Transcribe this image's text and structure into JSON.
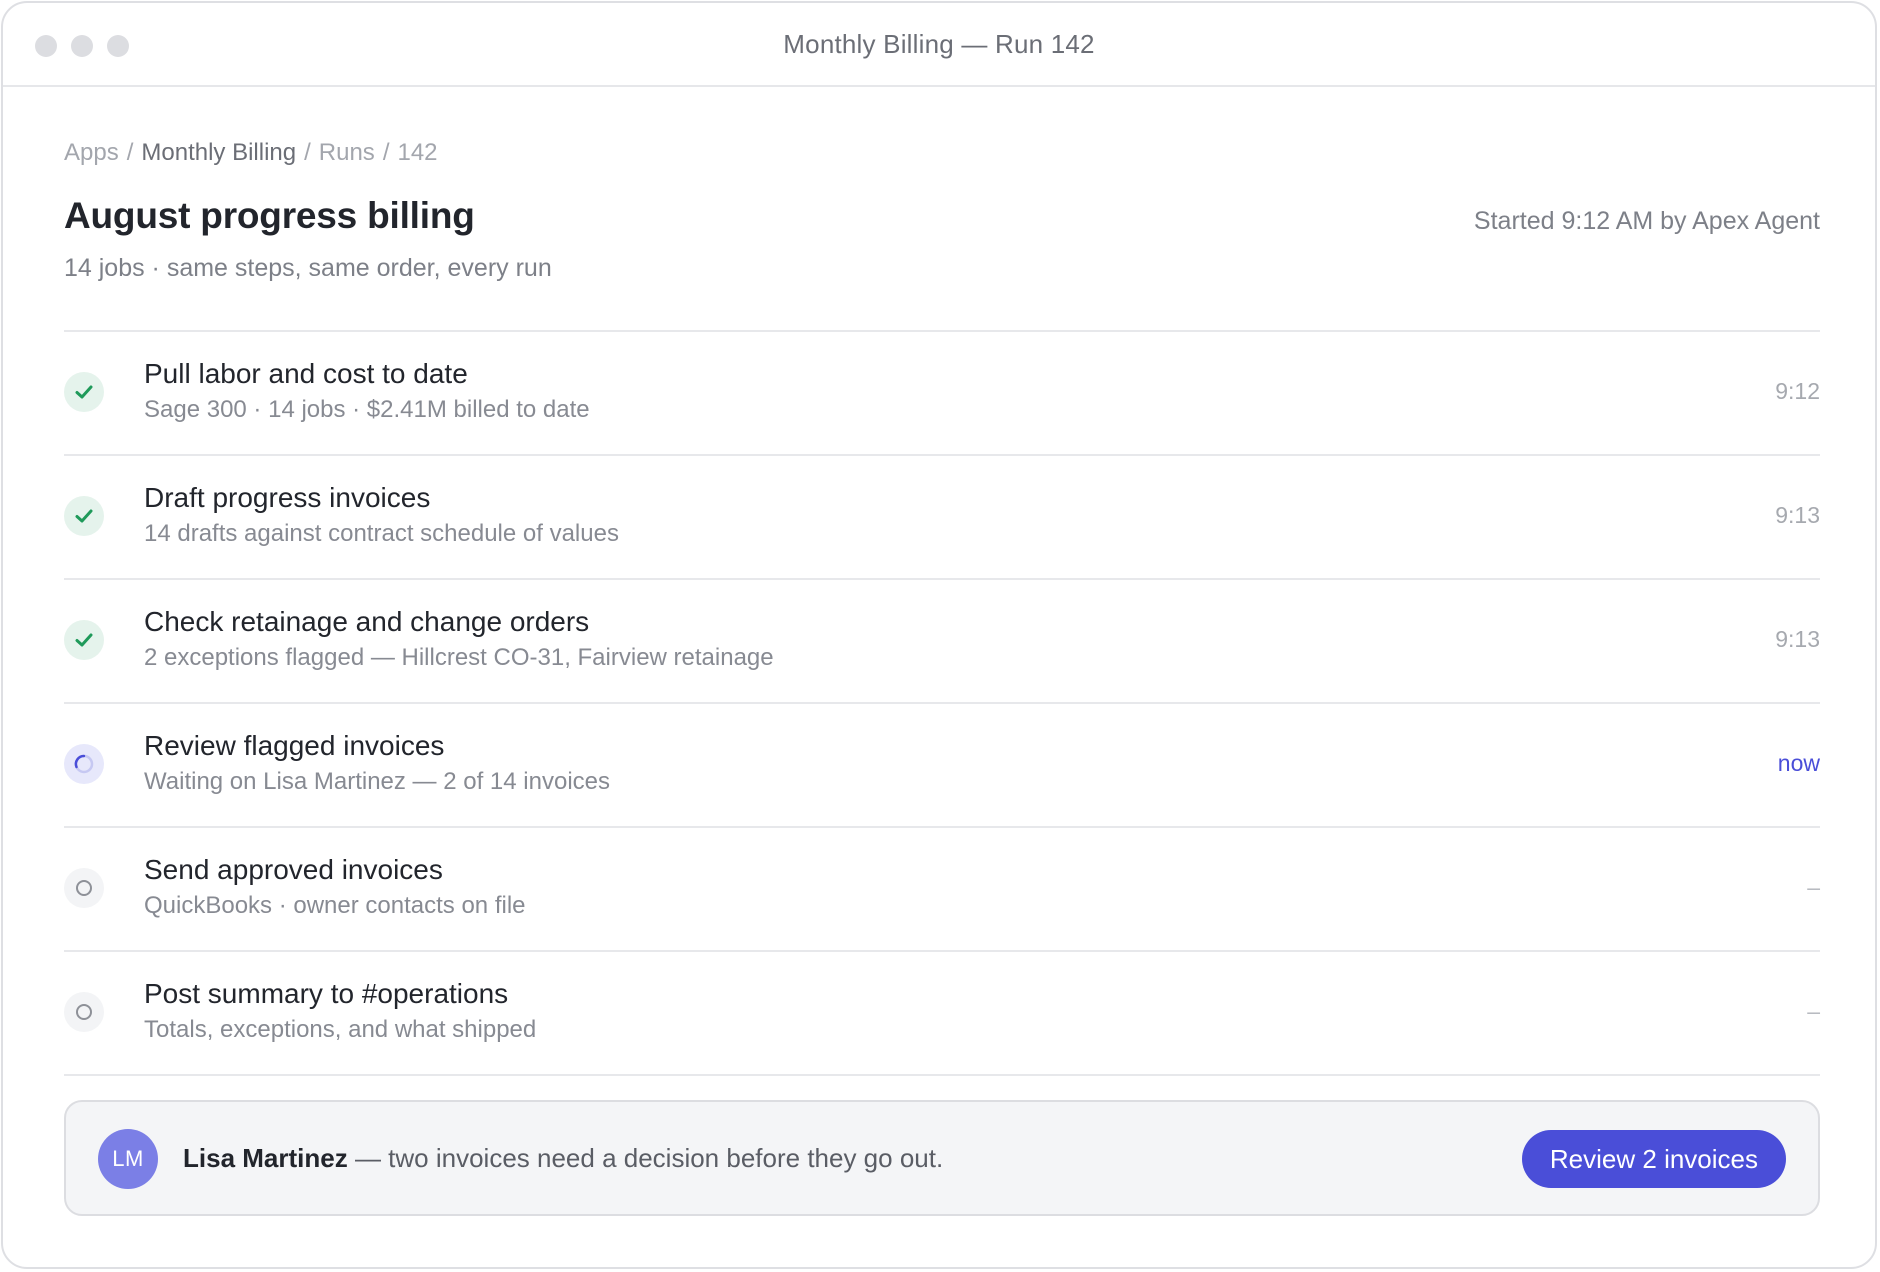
{
  "window": {
    "title": "Monthly Billing — Run 142"
  },
  "breadcrumb": {
    "items": [
      "Apps",
      "Monthly Billing",
      "Runs",
      "142"
    ],
    "separator": "/"
  },
  "header": {
    "title": "August progress billing",
    "started": "Started 9:12 AM by Apex Agent",
    "subtitle": "14 jobs · same steps, same order, every run"
  },
  "steps": [
    {
      "title": "Pull labor and cost to date",
      "detail": "Sage 300 · 14 jobs · $2.41M billed to date",
      "time": "9:12",
      "status": "done"
    },
    {
      "title": "Draft progress invoices",
      "detail": "14 drafts against contract schedule of values",
      "time": "9:13",
      "status": "done"
    },
    {
      "title": "Check retainage and change orders",
      "detail": "2 exceptions flagged — Hillcrest CO-31, Fairview retainage",
      "time": "9:13",
      "status": "done"
    },
    {
      "title": "Review flagged invoices",
      "detail": "Waiting on Lisa Martinez — 2 of 14 invoices",
      "time": "now",
      "status": "active"
    },
    {
      "title": "Send approved invoices",
      "detail": "QuickBooks · owner contacts on file",
      "time": "–",
      "status": "pending"
    },
    {
      "title": "Post summary to #operations",
      "detail": "Totals, exceptions, and what shipped",
      "time": "–",
      "status": "pending"
    }
  ],
  "banner": {
    "avatar_initials": "LM",
    "name": "Lisa Martinez",
    "message": " — two invoices need a decision before they go out.",
    "button_label": "Review 2 invoices"
  },
  "colors": {
    "accent": "#4a4ed8",
    "success": "#1f9a5a",
    "avatar": "#7b7fe6"
  }
}
